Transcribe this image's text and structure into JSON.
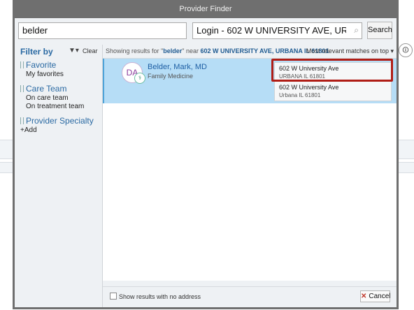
{
  "dialog": {
    "title": "Provider Finder"
  },
  "search": {
    "query": "belder",
    "location": "Login - 602 W UNIVERSITY AVE, URBAN…",
    "location_icon": "location-search-icon",
    "search_label": "Search"
  },
  "filter": {
    "title": "Filter by",
    "clear_label": "Clear",
    "groups": [
      {
        "label": "Favorite",
        "items": [
          "My favorites"
        ]
      },
      {
        "label": "Care Team",
        "items": [
          "On care team",
          "On treatment team"
        ]
      },
      {
        "label": "Provider Specialty",
        "items": [
          "+Add"
        ]
      }
    ]
  },
  "results": {
    "summary_prefix": "Showing results for \"",
    "summary_query": "belder",
    "summary_mid": "\" near ",
    "summary_location": "602 W UNIVERSITY AVE, URBANA IL 61801",
    "summary_end": ".",
    "sort": "Most relevant matches on top ▾",
    "items": [
      {
        "initials": "DA",
        "name": "Belder, Mark, MD",
        "specialty": "Family Medicine",
        "addresses": [
          {
            "line1": "602 W University Ave",
            "line2": "URBANA IL 61801"
          },
          {
            "line1": "602 W University Ave",
            "line2": "Urbana IL 61801"
          }
        ]
      }
    ]
  },
  "footer": {
    "show_no_address": "Show results with no address",
    "cancel_label": "Cancel"
  },
  "colors": {
    "accent": "#2b6aa3",
    "row_selected": "#b6ddf6",
    "highlight_border": "#b01d16"
  }
}
